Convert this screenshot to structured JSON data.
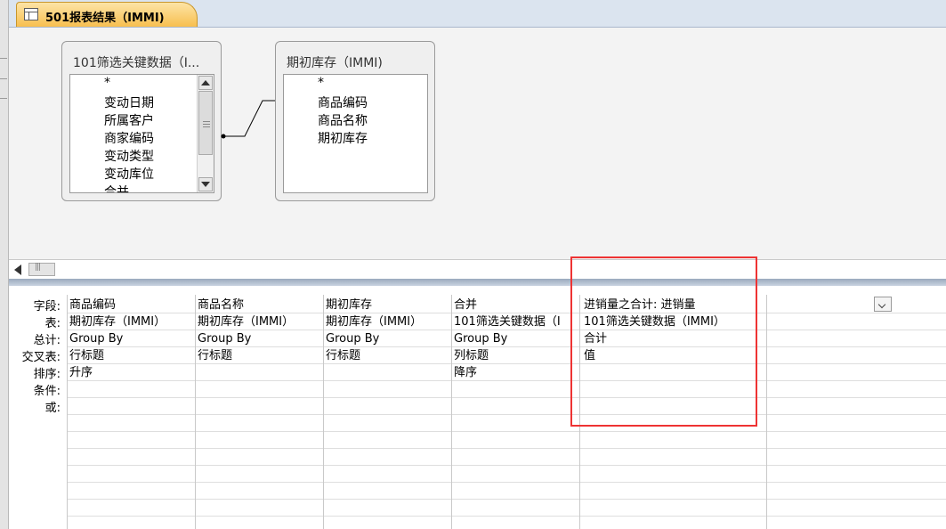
{
  "document_tab": {
    "title": "501报表结果（IMMI)"
  },
  "design_view": {
    "tables": [
      {
        "title": "101筛选关键数据（I...",
        "fields": [
          "*",
          "变动日期",
          "所属客户",
          "商家编码",
          "变动类型",
          "变动库位",
          "合并"
        ]
      },
      {
        "title": "期初库存（IMMI)",
        "fields": [
          "*",
          "商品编码",
          "商品名称",
          "期初库存"
        ]
      }
    ]
  },
  "query_grid": {
    "row_labels": [
      "字段:",
      "表:",
      "总计:",
      "交叉表:",
      "排序:",
      "条件:",
      "或:"
    ],
    "columns": [
      {
        "field": "商品编码",
        "table": "期初库存（IMMI）",
        "total": "Group By",
        "crosstab": "行标题",
        "sort": "升序"
      },
      {
        "field": "商品名称",
        "table": "期初库存（IMMI）",
        "total": "Group By",
        "crosstab": "行标题",
        "sort": ""
      },
      {
        "field": "期初库存",
        "table": "期初库存（IMMI）",
        "total": "Group By",
        "crosstab": "行标题",
        "sort": ""
      },
      {
        "field": "合并",
        "table": "101筛选关键数据（I",
        "total": "Group By",
        "crosstab": "列标题",
        "sort": "降序"
      },
      {
        "field": "进销量之合计: 进销量",
        "table": "101筛选关键数据（IMMI）",
        "total": "合计",
        "crosstab": "值",
        "sort": ""
      }
    ]
  },
  "colors": {
    "highlight": "#e33333",
    "tab_active": "#f7bf4f"
  }
}
